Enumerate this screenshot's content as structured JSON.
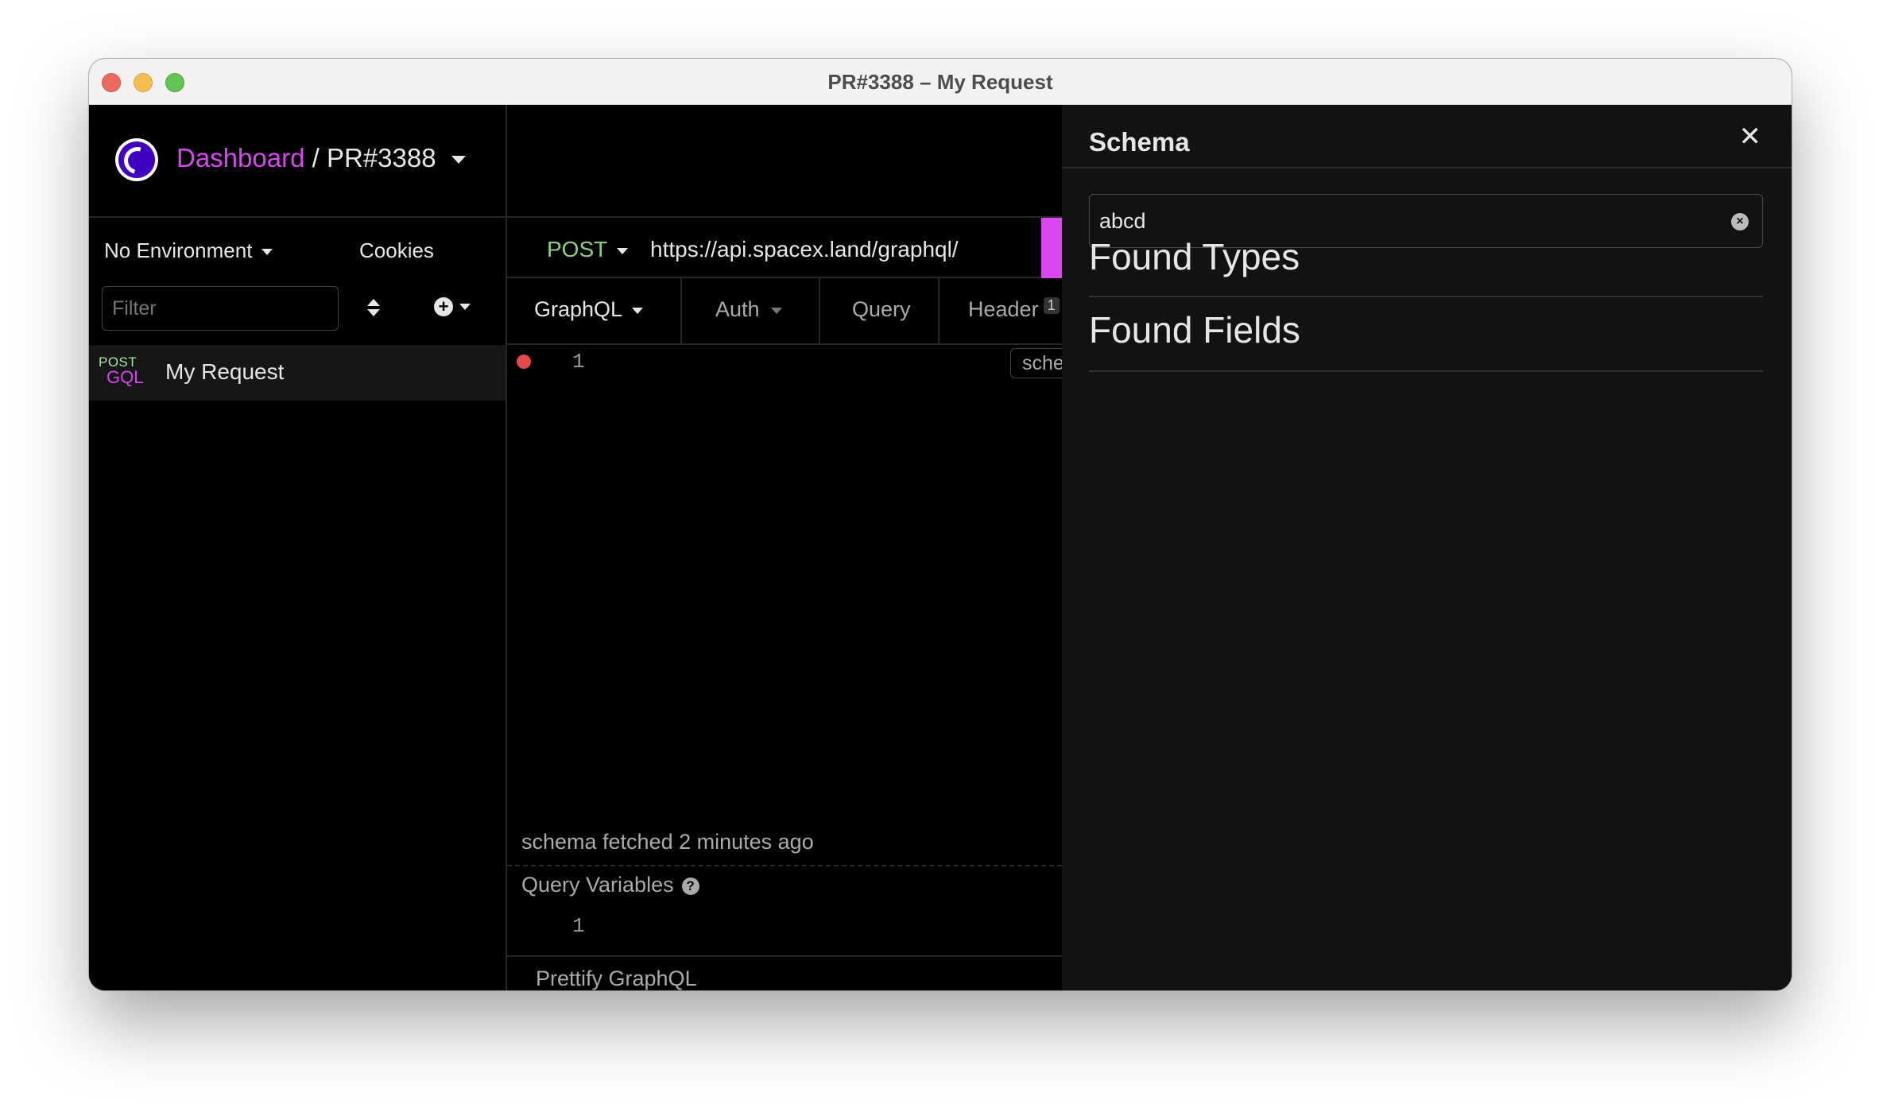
{
  "window": {
    "title": "PR#3388 – My Request"
  },
  "header": {
    "dashboard_link": "Dashboard",
    "separator": "/",
    "project": "PR#3388"
  },
  "sidebar": {
    "environment": "No Environment",
    "cookies": "Cookies",
    "filter_placeholder": "Filter",
    "requests": [
      {
        "method": "POST",
        "type": "GQL",
        "name": "My Request"
      }
    ]
  },
  "request": {
    "method": "POST",
    "url": "https://api.spacex.land/graphql/",
    "tabs": [
      {
        "label": "GraphQL",
        "active": true
      },
      {
        "label": "Auth"
      },
      {
        "label": "Query"
      },
      {
        "label": "Header",
        "badge": "1"
      }
    ],
    "editor_line": "1",
    "schema_button": "schema",
    "schema_status": "schema fetched 2 minutes ago",
    "query_variables_label": "Query Variables",
    "variables_line": "1",
    "prettify_label": "Prettify GraphQL"
  },
  "schema_panel": {
    "title": "Schema",
    "search_value": "abcd",
    "found_types": "Found Types",
    "found_fields": "Found Fields"
  },
  "colors": {
    "accent": "#d946ef",
    "post_method": "#8dd17f",
    "error": "#e5484d"
  }
}
